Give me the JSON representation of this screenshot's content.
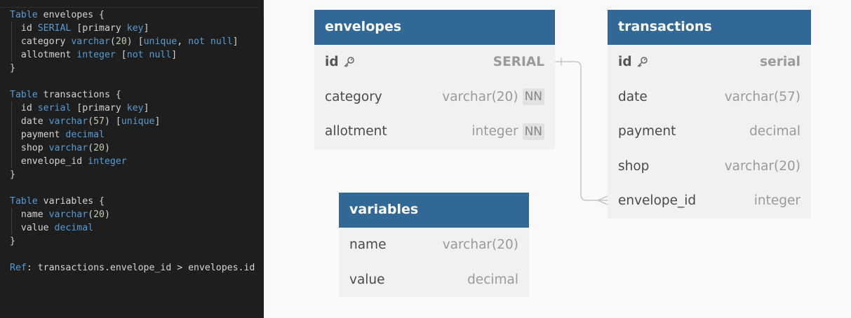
{
  "editor": {
    "lines": [
      [
        {
          "t": "Table",
          "c": "kw"
        },
        {
          "t": " envelopes {",
          "c": "pl"
        }
      ],
      [
        {
          "t": "  id ",
          "c": "pl"
        },
        {
          "t": "SERIAL",
          "c": "ty"
        },
        {
          "t": " [",
          "c": "pl"
        },
        {
          "t": "primary",
          "c": "pl"
        },
        {
          "t": " ",
          "c": "pl"
        },
        {
          "t": "key",
          "c": "kw"
        },
        {
          "t": "]",
          "c": "pl"
        }
      ],
      [
        {
          "t": "  category ",
          "c": "pl"
        },
        {
          "t": "varchar",
          "c": "ty"
        },
        {
          "t": "(",
          "c": "pl"
        },
        {
          "t": "20",
          "c": "num"
        },
        {
          "t": ") [",
          "c": "pl"
        },
        {
          "t": "unique",
          "c": "kw"
        },
        {
          "t": ", ",
          "c": "pl"
        },
        {
          "t": "not null",
          "c": "kw"
        },
        {
          "t": "]",
          "c": "pl"
        }
      ],
      [
        {
          "t": "  allotment ",
          "c": "pl"
        },
        {
          "t": "integer",
          "c": "ty"
        },
        {
          "t": " [",
          "c": "pl"
        },
        {
          "t": "not null",
          "c": "kw"
        },
        {
          "t": "]",
          "c": "pl"
        }
      ],
      [
        {
          "t": "}",
          "c": "pl"
        }
      ],
      [
        {
          "t": "",
          "c": "pl"
        }
      ],
      [
        {
          "t": "Table",
          "c": "kw"
        },
        {
          "t": " transactions {",
          "c": "pl"
        }
      ],
      [
        {
          "t": "  id ",
          "c": "pl"
        },
        {
          "t": "serial",
          "c": "ty"
        },
        {
          "t": " [",
          "c": "pl"
        },
        {
          "t": "primary",
          "c": "pl"
        },
        {
          "t": " ",
          "c": "pl"
        },
        {
          "t": "key",
          "c": "kw"
        },
        {
          "t": "]",
          "c": "pl"
        }
      ],
      [
        {
          "t": "  date ",
          "c": "pl"
        },
        {
          "t": "varchar",
          "c": "ty"
        },
        {
          "t": "(",
          "c": "pl"
        },
        {
          "t": "57",
          "c": "num"
        },
        {
          "t": ") [",
          "c": "pl"
        },
        {
          "t": "unique",
          "c": "kw"
        },
        {
          "t": "]",
          "c": "pl"
        }
      ],
      [
        {
          "t": "  payment ",
          "c": "pl"
        },
        {
          "t": "decimal",
          "c": "ty"
        }
      ],
      [
        {
          "t": "  shop ",
          "c": "pl"
        },
        {
          "t": "varchar",
          "c": "ty"
        },
        {
          "t": "(",
          "c": "pl"
        },
        {
          "t": "20",
          "c": "num"
        },
        {
          "t": ")",
          "c": "pl"
        }
      ],
      [
        {
          "t": "  envelope_id ",
          "c": "pl"
        },
        {
          "t": "integer",
          "c": "ty"
        }
      ],
      [
        {
          "t": "}",
          "c": "pl"
        }
      ],
      [
        {
          "t": "",
          "c": "pl"
        }
      ],
      [
        {
          "t": "Table",
          "c": "kw"
        },
        {
          "t": " variables {",
          "c": "pl"
        }
      ],
      [
        {
          "t": "  name ",
          "c": "pl"
        },
        {
          "t": "varchar",
          "c": "ty"
        },
        {
          "t": "(",
          "c": "pl"
        },
        {
          "t": "20",
          "c": "num"
        },
        {
          "t": ")",
          "c": "pl"
        }
      ],
      [
        {
          "t": "  value ",
          "c": "pl"
        },
        {
          "t": "decimal",
          "c": "ty"
        }
      ],
      [
        {
          "t": "}",
          "c": "pl"
        }
      ],
      [
        {
          "t": "",
          "c": "pl"
        }
      ],
      [
        {
          "t": "Ref",
          "c": "kw"
        },
        {
          "t": ": transactions.envelope_id > envelopes.id",
          "c": "pl"
        }
      ]
    ],
    "collapse_icon": "‹"
  },
  "tables": {
    "envelopes": {
      "name": "envelopes",
      "fields": [
        {
          "name": "id",
          "type": "SERIAL",
          "pk": true,
          "nn": ""
        },
        {
          "name": "category",
          "type": "varchar(20)",
          "pk": false,
          "nn": "NN"
        },
        {
          "name": "allotment",
          "type": "integer",
          "pk": false,
          "nn": "NN"
        }
      ]
    },
    "transactions": {
      "name": "transactions",
      "fields": [
        {
          "name": "id",
          "type": "serial",
          "pk": true,
          "nn": ""
        },
        {
          "name": "date",
          "type": "varchar(57)",
          "pk": false,
          "nn": ""
        },
        {
          "name": "payment",
          "type": "decimal",
          "pk": false,
          "nn": ""
        },
        {
          "name": "shop",
          "type": "varchar(20)",
          "pk": false,
          "nn": ""
        },
        {
          "name": "envelope_id",
          "type": "integer",
          "pk": false,
          "nn": ""
        }
      ]
    },
    "variables": {
      "name": "variables",
      "fields": [
        {
          "name": "name",
          "type": "varchar(20)",
          "pk": false,
          "nn": ""
        },
        {
          "name": "value",
          "type": "decimal",
          "pk": false,
          "nn": ""
        }
      ]
    }
  },
  "relationship": {
    "from": "transactions.envelope_id",
    "to": "envelopes.id",
    "type": "many-to-one"
  },
  "colors": {
    "header": "#316896",
    "editor_bg": "#1e1e1e",
    "keyword": "#569cd6",
    "number": "#b5cea8"
  },
  "icons": {
    "primary_key": "key-icon"
  }
}
